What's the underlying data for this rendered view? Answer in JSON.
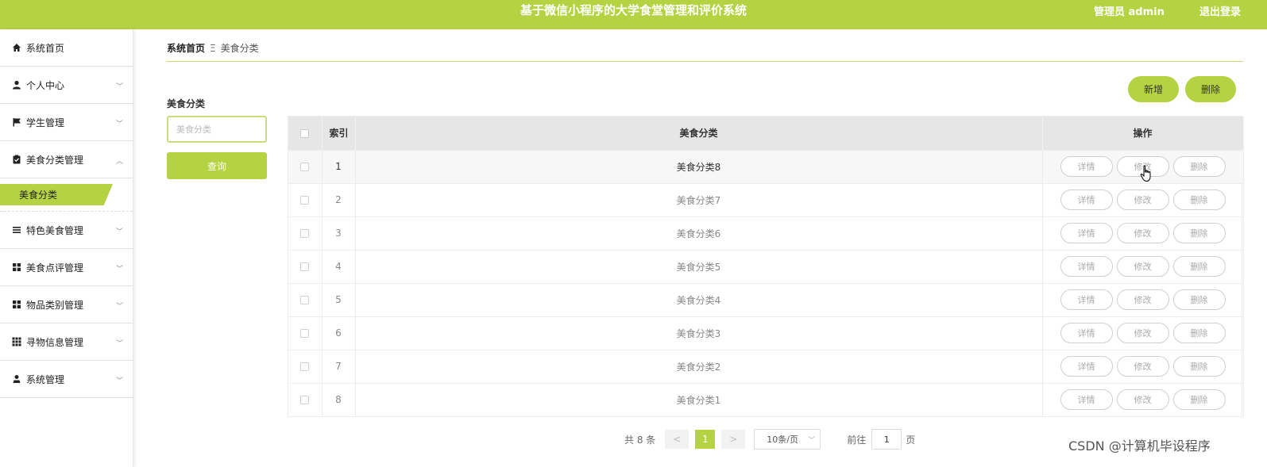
{
  "header": {
    "title": "基于微信小程序的大学食堂管理和评价系统",
    "admin": "管理员 admin",
    "logout": "退出登录",
    "bg_color": "#b5d242"
  },
  "sidebar": {
    "items": [
      {
        "label": "系统首页",
        "icon": "home-icon"
      },
      {
        "label": "个人中心",
        "icon": "user-icon"
      },
      {
        "label": "学生管理",
        "icon": "flag-icon"
      },
      {
        "label": "美食分类管理",
        "icon": "clipboard-icon",
        "expanded": true
      },
      {
        "label": "特色美食管理",
        "icon": "list-icon"
      },
      {
        "label": "美食点评管理",
        "icon": "grid-icon"
      },
      {
        "label": "物品类别管理",
        "icon": "grid-icon"
      },
      {
        "label": "寻物信息管理",
        "icon": "apps-icon"
      },
      {
        "label": "系统管理",
        "icon": "user-admin-icon"
      }
    ],
    "submenu_active": "美食分类"
  },
  "breadcrumb": {
    "home": "系统首页",
    "separator": "Ξ",
    "current": "美食分类"
  },
  "search": {
    "label": "美食分类",
    "placeholder": "美食分类",
    "button": "查询"
  },
  "actions": {
    "add": "新增",
    "delete": "删除"
  },
  "table": {
    "headers": {
      "index": "索引",
      "category": "美食分类",
      "operations": "操作"
    },
    "rows": [
      {
        "index": "1",
        "category": "美食分类8"
      },
      {
        "index": "2",
        "category": "美食分类7"
      },
      {
        "index": "3",
        "category": "美食分类6"
      },
      {
        "index": "4",
        "category": "美食分类5"
      },
      {
        "index": "5",
        "category": "美食分类4"
      },
      {
        "index": "6",
        "category": "美食分类3"
      },
      {
        "index": "7",
        "category": "美食分类2"
      },
      {
        "index": "8",
        "category": "美食分类1"
      }
    ],
    "row_buttons": {
      "detail": "详情",
      "edit": "修改",
      "delete": "删除"
    }
  },
  "pagination": {
    "total": "共 8 条",
    "prev": "<",
    "next": ">",
    "current_page": "1",
    "page_size": "10条/页",
    "goto_label": "前往",
    "goto_value": "1",
    "page_unit": "页"
  },
  "watermark": "CSDN @计算机毕设程序"
}
